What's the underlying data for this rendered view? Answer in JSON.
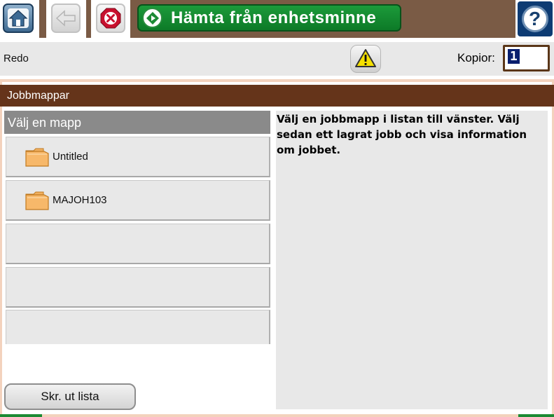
{
  "toolbar": {
    "home_icon": "home-icon",
    "back_icon": "back-arrow-icon",
    "stop_icon": "stop-icon",
    "title": "Hämta från enhetsminne",
    "title_icon": "start-diamond-icon",
    "help_icon": "help-icon",
    "help_glyph": "?",
    "colors": {
      "bar": "#7a5b45",
      "title_bg": "#0d7a27",
      "help_bg": "#0d3b73"
    }
  },
  "status": {
    "text": "Redo",
    "warning_icon": "warning-icon",
    "copies_label": "Kopior:",
    "copies_value": "1"
  },
  "section": {
    "title": "Jobbmappar",
    "color": "#65341a"
  },
  "folders": {
    "header": "Välj en mapp",
    "items": [
      {
        "label": "Untitled",
        "icon": "folder-icon"
      },
      {
        "label": "MAJOH103",
        "icon": "folder-icon"
      },
      {
        "label": ""
      },
      {
        "label": ""
      },
      {
        "label": ""
      }
    ]
  },
  "info": {
    "text": "Välj en jobbmapp i listan till vänster. Välj sedan ett lagrat jobb och visa information om jobbet."
  },
  "actions": {
    "print_list": "Skr. ut lista"
  }
}
